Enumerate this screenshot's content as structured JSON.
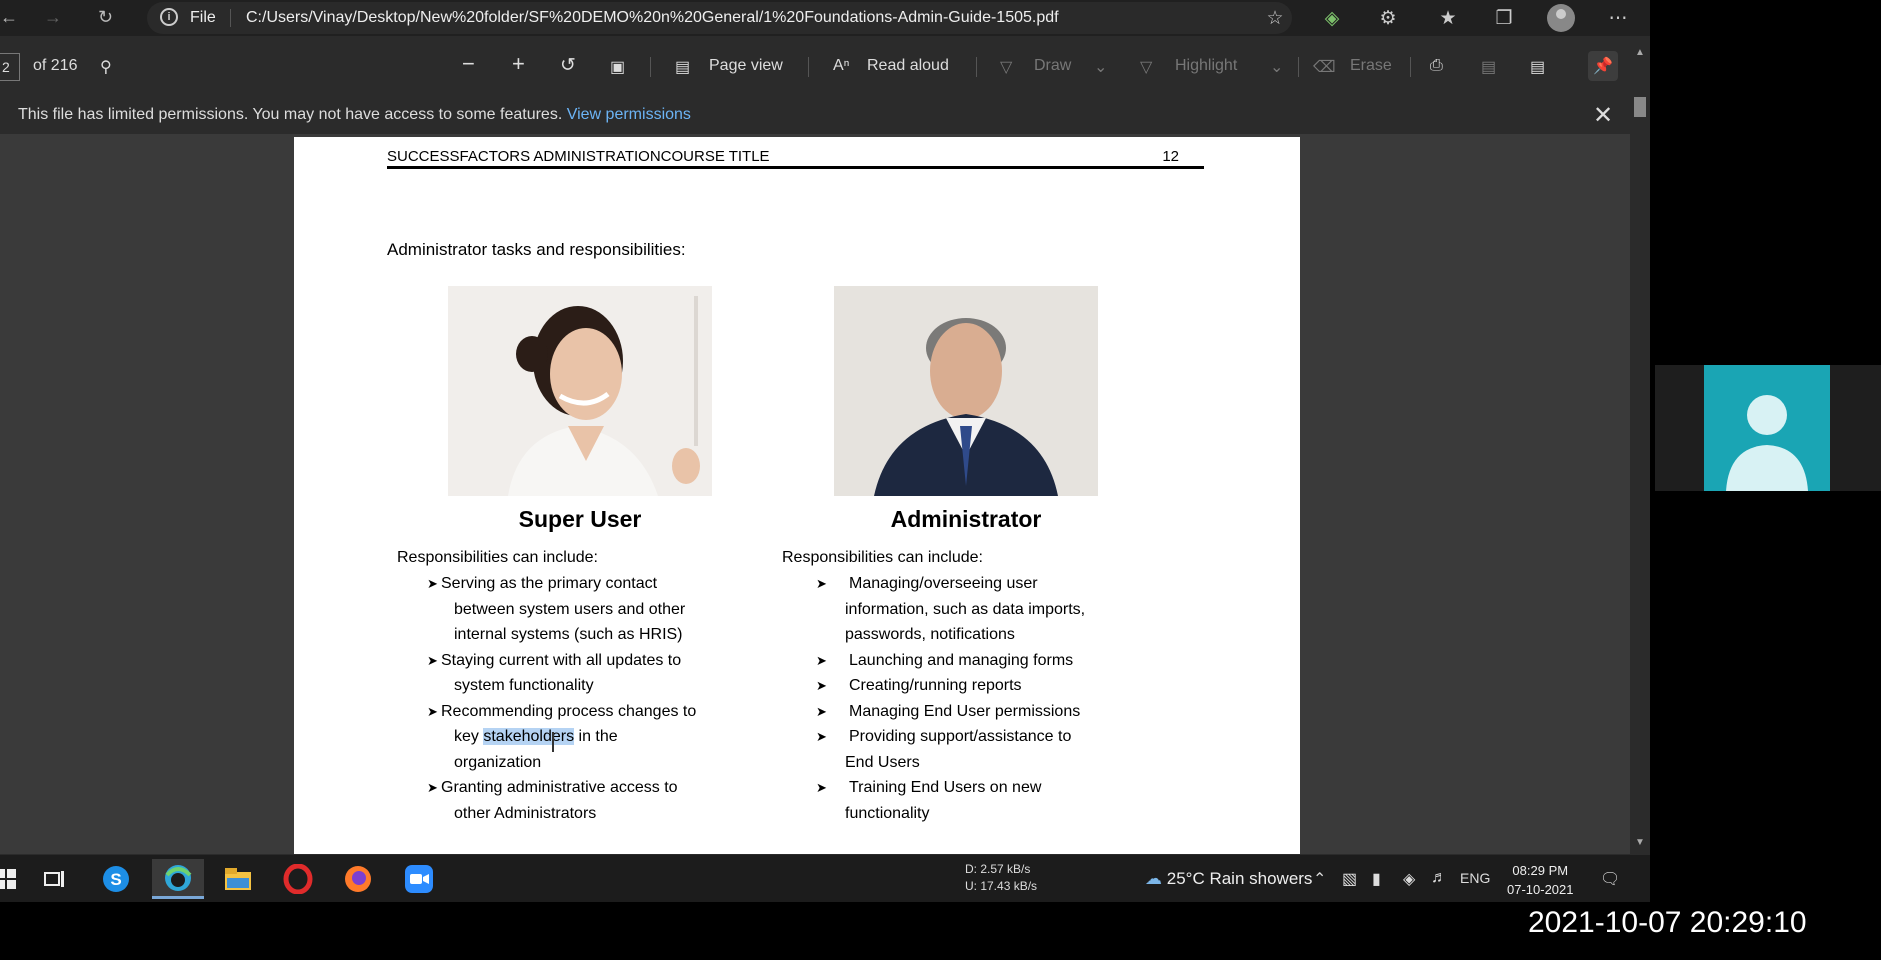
{
  "browser": {
    "file_label": "File",
    "url": "C:/Users/Vinay/Desktop/New%20folder/SF%20DEMO%20n%20General/1%20Foundations-Admin-Guide-1505.pdf"
  },
  "pdf_toolbar": {
    "page_number": "2",
    "page_total": "of 216",
    "page_view": "Page view",
    "read_aloud": "Read aloud",
    "draw": "Draw",
    "highlight": "Highlight",
    "erase": "Erase"
  },
  "permission_bar": {
    "message": "This file has limited permissions. You may not have access to some features.",
    "link": "View permissions"
  },
  "page": {
    "header_title": "SUCCESSFACTORS ADMINISTRATIONCOURSE TITLE",
    "header_page": "12",
    "intro": "Administrator tasks and responsibilities:",
    "left": {
      "title": "Super User",
      "head": "Responsibilities can include:",
      "bullets": [
        [
          "Serving as the primary contact",
          "between system users and other",
          "internal systems (such as HRIS)"
        ],
        [
          "Staying current with all updates to",
          "system functionality"
        ],
        [
          "Recommending process changes to"
        ],
        [
          "Granting administrative access to",
          "other Administrators"
        ]
      ],
      "b3_key": "key",
      "b3_highlight": "stakeholders",
      "b3_rest": "in the",
      "b3_line3": "organization"
    },
    "right": {
      "title": "Administrator",
      "head": "Responsibilities can include:",
      "bullets": [
        [
          "Managing/overseeing user",
          "information, such as data imports,",
          "passwords, notifications"
        ],
        [
          "Launching and managing forms"
        ],
        [
          "Creating/running reports"
        ],
        [
          "Managing End User permissions"
        ],
        [
          "Providing support/assistance to",
          "End Users"
        ],
        [
          "Training End Users on new",
          "functionality"
        ]
      ]
    }
  },
  "taskbar": {
    "net_down": "D:    2.57 kB/s",
    "net_up": "U:   17.43 kB/s",
    "weather": "25°C  Rain showers",
    "language": "ENG",
    "time": "08:29 PM",
    "date": "07-10-2021"
  },
  "timestamp": "2021-10-07  20:29:10"
}
